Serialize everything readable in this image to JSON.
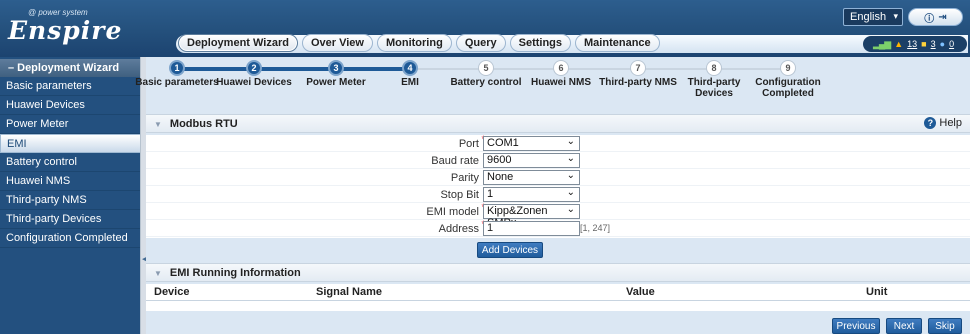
{
  "brand": {
    "small": "@ power system",
    "big": "Enspire"
  },
  "language": {
    "selected": "English"
  },
  "top_icons": {
    "info": "ⓘ",
    "logout": "⇥"
  },
  "tabs": [
    {
      "label": "Deployment Wizard"
    },
    {
      "label": "Over View"
    },
    {
      "label": "Monitoring"
    },
    {
      "label": "Query"
    },
    {
      "label": "Settings"
    },
    {
      "label": "Maintenance"
    }
  ],
  "alarms": {
    "major": "13",
    "minor": "3",
    "warning": "0"
  },
  "sidebar": {
    "title": "Deployment Wizard",
    "items": [
      {
        "label": "Basic parameters"
      },
      {
        "label": "Huawei Devices"
      },
      {
        "label": "Power Meter"
      },
      {
        "label": "EMI"
      },
      {
        "label": "Battery control"
      },
      {
        "label": "Huawei NMS"
      },
      {
        "label": "Third-party NMS"
      },
      {
        "label": "Third-party Devices"
      },
      {
        "label": "Configuration Completed"
      }
    ]
  },
  "steps": [
    {
      "num": "1",
      "label": "Basic parameters",
      "state": "done"
    },
    {
      "num": "2",
      "label": "Huawei Devices",
      "state": "done"
    },
    {
      "num": "3",
      "label": "Power Meter",
      "state": "done"
    },
    {
      "num": "4",
      "label": "EMI",
      "state": "done"
    },
    {
      "num": "5",
      "label": "Battery control",
      "state": "todo"
    },
    {
      "num": "6",
      "label": "Huawei NMS",
      "state": "todo"
    },
    {
      "num": "7",
      "label": "Third-party NMS",
      "state": "todo"
    },
    {
      "num": "8",
      "label": "Third-party\nDevices",
      "state": "todo"
    },
    {
      "num": "9",
      "label": "Configuration\nCompleted",
      "state": "todo"
    }
  ],
  "modbus": {
    "title": "Modbus RTU",
    "help": "Help",
    "fields": {
      "port": {
        "label": "Port",
        "value": "COM1"
      },
      "baud": {
        "label": "Baud rate",
        "value": "9600"
      },
      "parity": {
        "label": "Parity",
        "value": "None"
      },
      "stopbit": {
        "label": "Stop Bit",
        "value": "1"
      },
      "model": {
        "label": "EMI model",
        "value": "Kipp&Zonen SMPx"
      },
      "address": {
        "label": "Address",
        "value": "1",
        "range": "[1, 247]"
      }
    },
    "add_button": "Add Devices"
  },
  "running": {
    "title": "EMI Running Information",
    "columns": {
      "device": "Device",
      "signal": "Signal Name",
      "value": "Value",
      "unit": "Unit"
    }
  },
  "footer": {
    "previous": "Previous",
    "next": "Next",
    "skip": "Skip"
  },
  "colors": {
    "header_bg": "#24507c",
    "sidebar_bg": "#23507f",
    "accent": "#1e5a97",
    "main_bg": "#dbe7f3"
  }
}
